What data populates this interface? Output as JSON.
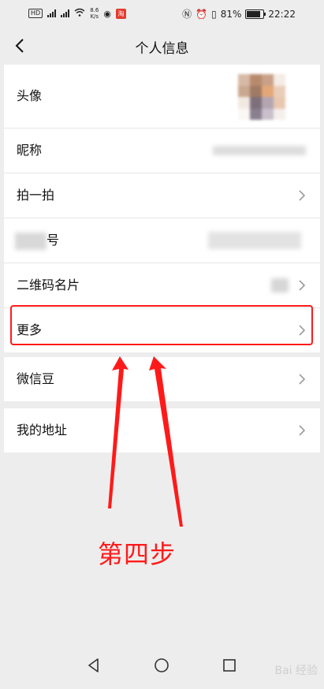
{
  "statusbar": {
    "hd": "HD",
    "net_speed": "8.6\nK/s",
    "app_badge": "淘",
    "battery": "81%",
    "battery_level": 0.81,
    "time": "22:22"
  },
  "nav": {
    "title": "个人信息"
  },
  "rows": {
    "avatar": "头像",
    "nickname": "昵称",
    "pat": "拍一拍",
    "wechat_id_suffix": "号",
    "qrcode": "二维码名片",
    "more": "更多",
    "wechat_beans": "微信豆",
    "address": "我的地址"
  },
  "annotation": {
    "step": "第四步"
  },
  "watermark": "Bai 经验"
}
